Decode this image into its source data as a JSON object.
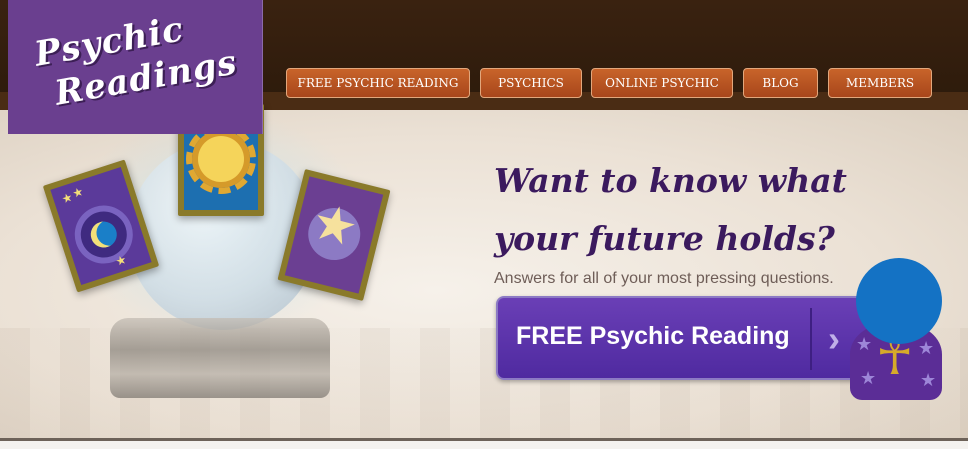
{
  "logo": {
    "line1": "Psychic",
    "line2": "Readings"
  },
  "nav": {
    "items": [
      {
        "label": "FREE PSYCHIC READING"
      },
      {
        "label": "PSYCHICS"
      },
      {
        "label": "ONLINE PSYCHIC"
      },
      {
        "label": "BLOG"
      },
      {
        "label": "MEMBERS"
      }
    ],
    "accent": "#b5521f"
  },
  "hero": {
    "headline_line1": "Want to know what",
    "headline_line2": "your future holds?",
    "subline": "Answers for all of your most pressing questions.",
    "cta_label": "FREE Psychic Reading",
    "cta_chevron": "›",
    "cta_color": "#5b32a8",
    "headline_color": "#3b1a5e"
  },
  "icons": {
    "card_moon": "moon-tarot-card-icon",
    "card_sun": "sun-tarot-card-icon",
    "card_star": "star-tarot-card-icon",
    "crystal_ball": "crystal-ball-icon",
    "wizard": "ankh-wizard-icon"
  }
}
